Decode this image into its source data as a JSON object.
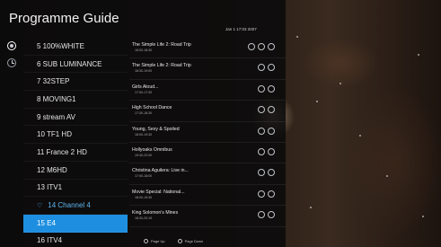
{
  "header": {
    "title": "Programme Guide",
    "clock": "Jan 1 17:03 2007"
  },
  "side_nav": [
    {
      "icon": "channel-list-icon",
      "active": true
    },
    {
      "icon": "clock-icon",
      "active": false
    }
  ],
  "channels": [
    {
      "label": "5 100%WHITE"
    },
    {
      "label": "6 SUB LUMINANCE"
    },
    {
      "label": "7 32STEP"
    },
    {
      "label": "8 MOVING1"
    },
    {
      "label": "9 stream AV"
    },
    {
      "label": "10 TF1 HD"
    },
    {
      "label": "11 France 2 HD"
    },
    {
      "label": "12 M6HD"
    },
    {
      "label": "13 ITV1"
    },
    {
      "label": "14 Channel 4",
      "favourite": true
    },
    {
      "label": "15 E4",
      "selected": true
    },
    {
      "label": "16 ITV4"
    }
  ],
  "programmes": [
    {
      "title": "The Simple Life 2: Road Trip",
      "time": "18:00-18:30",
      "icons": 3
    },
    {
      "title": "The Simple Life 2: Road Trip",
      "time": "18:30-19:00",
      "icons": 2
    },
    {
      "title": "Girls Aloud...",
      "time": "17:00-17:30",
      "icons": 2
    },
    {
      "title": "High School Dance",
      "time": "17:30-18:30",
      "icons": 2
    },
    {
      "title": "Young, Sexy & Spoiled",
      "time": "18:00-19:30",
      "icons": 2
    },
    {
      "title": "Hollyoaks Omnibus",
      "time": "19:30-22:00",
      "icons": 2
    },
    {
      "title": "Christina Aguilera: Live in...",
      "time": "17:00-18:00",
      "icons": 2
    },
    {
      "title": "Movie Special: National...",
      "time": "18:00-19:30",
      "icons": 2
    },
    {
      "title": "King Solomon's Mines",
      "time": "18:30-20:15",
      "icons": 2
    }
  ],
  "footer": {
    "page_up": "Page Up",
    "page_down": "Page Down"
  },
  "colors": {
    "accent": "#1e8fe0",
    "favourite": "#5db7f0"
  }
}
